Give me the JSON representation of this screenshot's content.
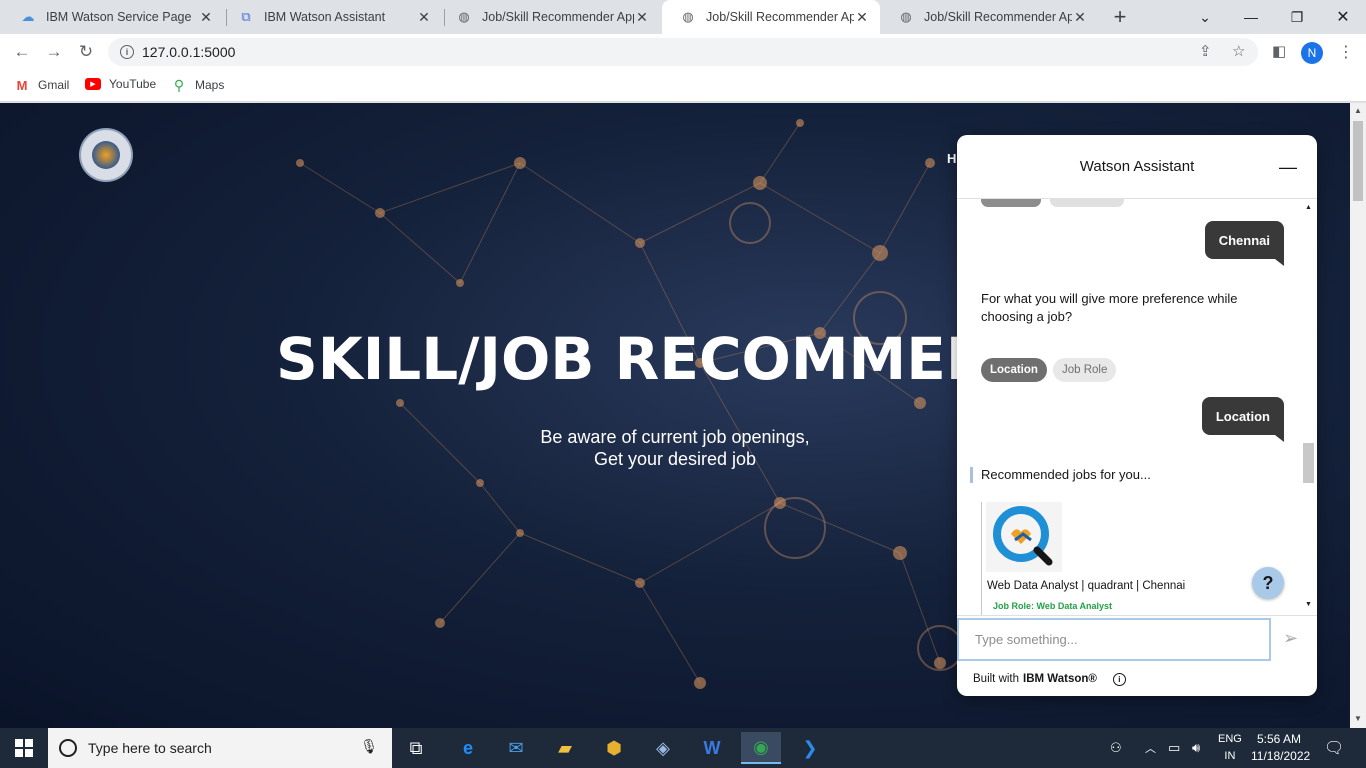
{
  "browser": {
    "tabs": [
      {
        "title": "IBM Watson Service Page",
        "icon": "cloud-icon"
      },
      {
        "title": "IBM Watson Assistant",
        "icon": "assistant-icon"
      },
      {
        "title": "Job/Skill Recommender Appl",
        "icon": "globe-icon"
      },
      {
        "title": "Job/Skill Recommender Appl",
        "icon": "globe-icon"
      },
      {
        "title": "Job/Skill Recommender Appl",
        "icon": "globe-icon"
      }
    ],
    "active_tab": 3,
    "address": "127.0.0.1:5000",
    "profile_initial": "N",
    "bookmarks": [
      {
        "label": "Gmail",
        "icon": "gmail-icon"
      },
      {
        "label": "YouTube",
        "icon": "youtube-icon"
      },
      {
        "label": "Maps",
        "icon": "maps-icon"
      }
    ]
  },
  "page": {
    "nav_partial": "H",
    "hero_title": "SKILL/JOB RECOMMEN",
    "hero_sub_1": "Be aware of current job openings,",
    "hero_sub_2": "Get your desired job"
  },
  "watson": {
    "title": "Watson Assistant",
    "messages": {
      "user_1": "Chennai",
      "bot_1": "For what you will give more preference while choosing a job?",
      "chip_selected": "Location",
      "chip_other": "Job Role",
      "user_2": "Location",
      "bot_2": "Recommended jobs for you...",
      "card_title": "Web Data Analyst | quadrant | Chennai",
      "card_role": "Job Role: Web Data Analyst"
    },
    "input_placeholder": "Type something...",
    "footer_prefix": "Built with",
    "footer_brand": "IBM Watson®",
    "help_label": "?"
  },
  "taskbar": {
    "search_placeholder": "Type here to search",
    "lang_1": "ENG",
    "lang_2": "IN",
    "time": "5:56 AM",
    "date": "11/18/2022"
  }
}
